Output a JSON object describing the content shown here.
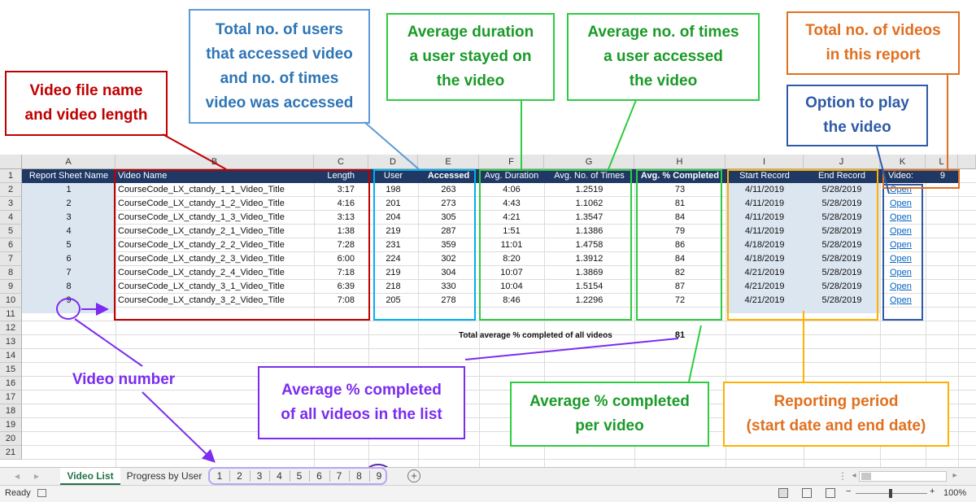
{
  "columns": [
    "A",
    "B",
    "C",
    "D",
    "E",
    "F",
    "G",
    "H",
    "I",
    "J",
    "K",
    "L"
  ],
  "row_numbers": [
    "1",
    "2",
    "3",
    "4",
    "5",
    "6",
    "7",
    "8",
    "9",
    "10",
    "11",
    "12",
    "13",
    "14",
    "15",
    "16",
    "17",
    "18",
    "19",
    "20",
    "21"
  ],
  "headers": {
    "report_sheet_name": "Report Sheet Name",
    "video_name": "Video Name",
    "length": "Length",
    "user": "User",
    "accessed": "Accessed",
    "avg_duration": "Avg. Duration",
    "avg_times": "Avg. No. of Times",
    "avg_completed": "Avg. % Completed",
    "start_record": "Start Record",
    "end_record": "End Record",
    "video_label": "Video:",
    "video_count": "9"
  },
  "rows": [
    {
      "num": "1",
      "name": "CourseCode_LX_ctandy_1_1_Video_Title",
      "length": "3:17",
      "user": "198",
      "accessed": "263",
      "duration": "4:06",
      "times": "1.2519",
      "completed": "73",
      "start": "4/11/2019",
      "end": "5/28/2019",
      "link": "Open"
    },
    {
      "num": "2",
      "name": "CourseCode_LX_ctandy_1_2_Video_Title",
      "length": "4:16",
      "user": "201",
      "accessed": "273",
      "duration": "4:43",
      "times": "1.1062",
      "completed": "81",
      "start": "4/11/2019",
      "end": "5/28/2019",
      "link": "Open"
    },
    {
      "num": "3",
      "name": "CourseCode_LX_ctandy_1_3_Video_Title",
      "length": "3:13",
      "user": "204",
      "accessed": "305",
      "duration": "4:21",
      "times": "1.3547",
      "completed": "84",
      "start": "4/11/2019",
      "end": "5/28/2019",
      "link": "Open"
    },
    {
      "num": "4",
      "name": "CourseCode_LX_ctandy_2_1_Video_Title",
      "length": "1:38",
      "user": "219",
      "accessed": "287",
      "duration": "1:51",
      "times": "1.1386",
      "completed": "79",
      "start": "4/11/2019",
      "end": "5/28/2019",
      "link": "Open"
    },
    {
      "num": "5",
      "name": "CourseCode_LX_ctandy_2_2_Video_Title",
      "length": "7:28",
      "user": "231",
      "accessed": "359",
      "duration": "11:01",
      "times": "1.4758",
      "completed": "86",
      "start": "4/18/2019",
      "end": "5/28/2019",
      "link": "Open"
    },
    {
      "num": "6",
      "name": "CourseCode_LX_ctandy_2_3_Video_Title",
      "length": "6:00",
      "user": "224",
      "accessed": "302",
      "duration": "8:20",
      "times": "1.3912",
      "completed": "84",
      "start": "4/18/2019",
      "end": "5/28/2019",
      "link": "Open"
    },
    {
      "num": "7",
      "name": "CourseCode_LX_ctandy_2_4_Video_Title",
      "length": "7:18",
      "user": "219",
      "accessed": "304",
      "duration": "10:07",
      "times": "1.3869",
      "completed": "82",
      "start": "4/21/2019",
      "end": "5/28/2019",
      "link": "Open"
    },
    {
      "num": "8",
      "name": "CourseCode_LX_ctandy_3_1_Video_Title",
      "length": "6:39",
      "user": "218",
      "accessed": "330",
      "duration": "10:04",
      "times": "1.5154",
      "completed": "87",
      "start": "4/21/2019",
      "end": "5/28/2019",
      "link": "Open"
    },
    {
      "num": "9",
      "name": "CourseCode_LX_ctandy_3_2_Video_Title",
      "length": "7:08",
      "user": "205",
      "accessed": "278",
      "duration": "8:46",
      "times": "1.2296",
      "completed": "72",
      "start": "4/21/2019",
      "end": "5/28/2019",
      "link": "Open"
    }
  ],
  "total": {
    "label": "Total average % completed of all videos",
    "value": "81"
  },
  "annotations": {
    "file_name": [
      "Video file name",
      "and video length"
    ],
    "users": [
      "Total no. of users",
      "that accessed video",
      "and no. of times",
      "video was accessed"
    ],
    "avg_duration": [
      "Average duration",
      "a user stayed on",
      "the video"
    ],
    "avg_times": [
      "Average no. of times",
      "a user accessed",
      "the video"
    ],
    "total_videos": [
      "Total no. of videos",
      "in this report"
    ],
    "play": [
      "Option to play",
      "the video"
    ],
    "video_number": "Video number",
    "avg_all": [
      "Average % completed",
      "of all videos in the list"
    ],
    "avg_per_video": [
      "Average % completed",
      "per video"
    ],
    "period": [
      "Reporting period",
      "(start date and end date)"
    ]
  },
  "tabs": {
    "video_list": "Video List",
    "progress_by_user": "Progress by User",
    "numbered": [
      "1",
      "2",
      "3",
      "4",
      "5",
      "6",
      "7",
      "8",
      "9"
    ],
    "add_sheet": "+"
  },
  "status": {
    "ready": "Ready",
    "zoom": "100%"
  },
  "colors": {
    "header_band": "#1f3864",
    "red": "#c00000",
    "blue_light": "#00b0f0",
    "green": "#2ecc40",
    "gold": "#ffb000",
    "orange": "#e07020",
    "navy": "#2e5aa7",
    "purple": "#7b2cf0"
  }
}
